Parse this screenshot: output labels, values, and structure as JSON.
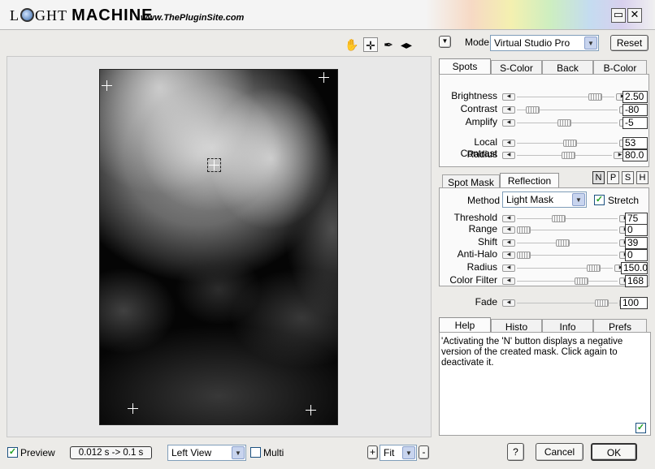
{
  "title": {
    "logo_pre": "L",
    "logo_mid": "GHT",
    "logo_main": "MACHINE",
    "site": "www.ThePluginSite.com"
  },
  "toolbar": {
    "icons": [
      "hand-icon",
      "crosshair-icon",
      "eyedropper-icon",
      "split-arrows-icon"
    ]
  },
  "mode": {
    "label": "Mode",
    "value": "Virtual Studio Pro",
    "reset": "Reset"
  },
  "top_tabs": [
    "Spots",
    "S-Color",
    "Back",
    "B-Color"
  ],
  "spots_sliders": [
    {
      "label": "Brightness",
      "value": "2.50",
      "pos": 0.85
    },
    {
      "label": "Contrast",
      "value": "-80",
      "pos": 0.1
    },
    {
      "label": "Amplify",
      "value": "-5",
      "pos": 0.47
    },
    {
      "label": "Local Contrast",
      "value": "53",
      "pos": 0.53
    },
    {
      "label": "Radius",
      "value": "80.0",
      "pos": 0.55
    }
  ],
  "mid_tabs": [
    "Spot Mask",
    "Reflection"
  ],
  "npsh": [
    "N",
    "P",
    "S",
    "H"
  ],
  "method": {
    "label": "Method",
    "value": "Light Mask",
    "stretch": "Stretch"
  },
  "reflection_sliders": [
    {
      "label": "Threshold",
      "value": "75",
      "pos": 0.4
    },
    {
      "label": "Range",
      "value": "0",
      "pos": 0.0
    },
    {
      "label": "Shift",
      "value": "39",
      "pos": 0.45
    },
    {
      "label": "Anti-Halo",
      "value": "0",
      "pos": 0.0
    },
    {
      "label": "Radius",
      "value": "150.0",
      "pos": 0.85
    },
    {
      "label": "Color Filter",
      "value": "168",
      "pos": 0.66
    }
  ],
  "fade": {
    "label": "Fade",
    "value": "100",
    "pos": 0.9
  },
  "bottom_tabs": [
    "Help",
    "Histo",
    "Info",
    "Prefs"
  ],
  "help_text": "'Activating the 'N' button displays a negative version of the created mask. Click again to deactivate it.",
  "footer": {
    "preview": "Preview",
    "timing": "0.012 s -> 0.1 s",
    "view": "Left View",
    "multi": "Multi",
    "zoom_plus": "+",
    "zoom": "Fit",
    "zoom_minus": "-",
    "help": "?",
    "cancel": "Cancel",
    "ok": "OK"
  }
}
